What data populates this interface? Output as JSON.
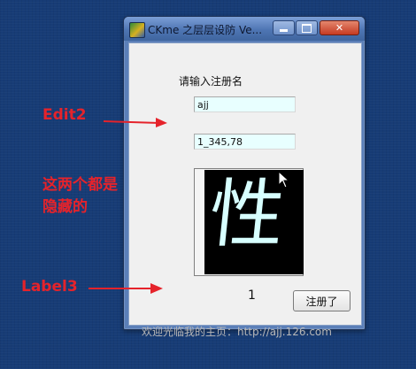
{
  "window": {
    "title": "CKme 之层层设防  Ve...",
    "icon": "app-icon"
  },
  "form": {
    "prompt_label": "请输入注册名",
    "edit1_value": "ajj",
    "edit2_value": "1_345,78",
    "captcha_char": "性",
    "number_label": "1",
    "register_button": "注册了",
    "homepage_label": "欢迎光临我的主页：http://ajj.126.com"
  },
  "annotations": {
    "edit2": "Edit2",
    "hidden_line1": "这两个都是",
    "hidden_line2": "隐藏的",
    "label3": "Label3",
    "color": "#e5232b"
  },
  "colors": {
    "desktop": "#173c76",
    "edit_background": "#e8ffff",
    "client_background": "#f0f0f0"
  }
}
